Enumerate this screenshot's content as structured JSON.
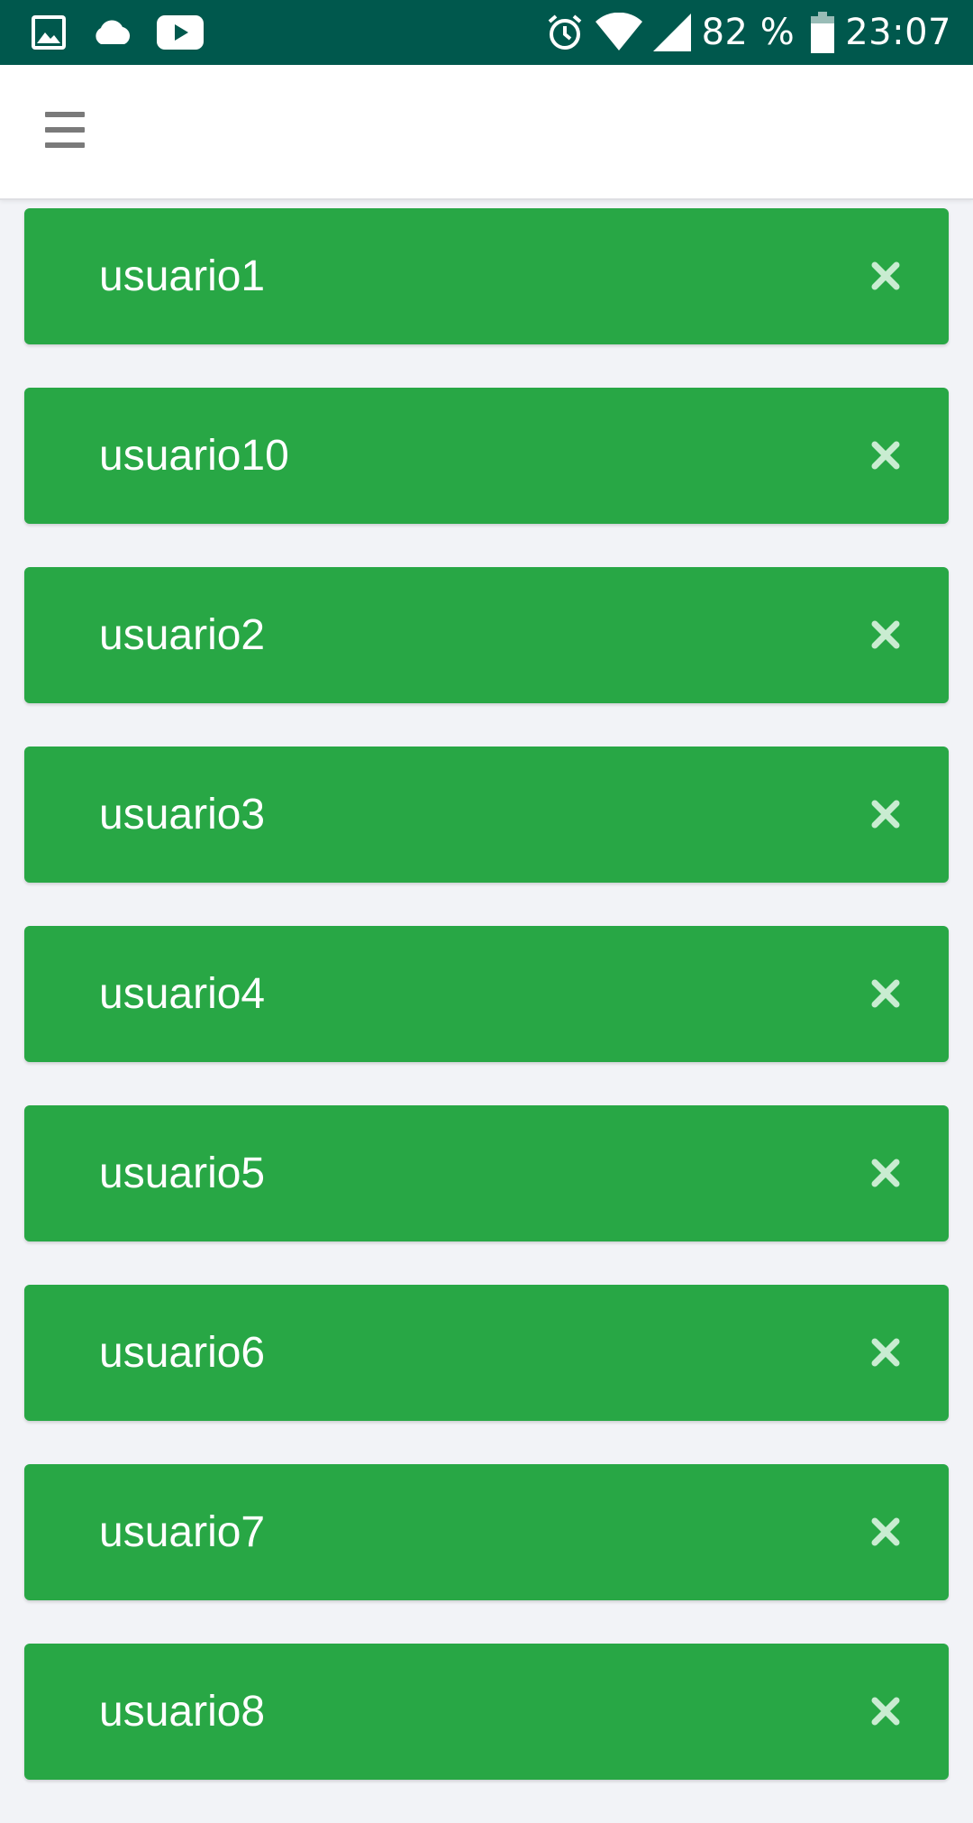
{
  "status_bar": {
    "battery_percent": "82 %",
    "time": "23:07",
    "left_icons": [
      "image-icon",
      "cloud-icon",
      "youtube-icon"
    ],
    "right_icons": [
      "alarm-icon",
      "wifi-icon",
      "signal-icon",
      "battery-icon"
    ]
  },
  "header": {
    "menu_icon": "hamburger-menu-icon"
  },
  "users": [
    {
      "label": "usuario1"
    },
    {
      "label": "usuario10"
    },
    {
      "label": "usuario2"
    },
    {
      "label": "usuario3"
    },
    {
      "label": "usuario4"
    },
    {
      "label": "usuario5"
    },
    {
      "label": "usuario6"
    },
    {
      "label": "usuario7"
    },
    {
      "label": "usuario8"
    }
  ],
  "item_action_icon": "close-icon",
  "colors": {
    "status_bar": "#00584d",
    "item_background": "#28a745",
    "page_background": "#f2f3f7",
    "delete_icon": "#c9ecd1"
  }
}
